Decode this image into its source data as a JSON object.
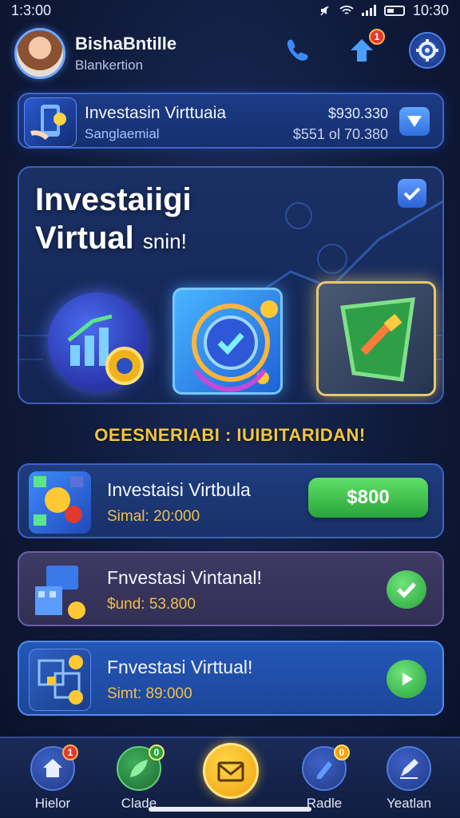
{
  "status": {
    "time": "1:3:00",
    "clock": "10:30"
  },
  "header": {
    "name": "BishaBntille",
    "subtitle": "Blankertion",
    "notif_count": "1"
  },
  "top_card": {
    "title": "Investasin Virttuaia",
    "subtitle": "Sanglaemial",
    "value1": "$930.330",
    "value2": "$551 ol 70.380"
  },
  "hero": {
    "line1": "Investaiigi",
    "line2": "Virtual",
    "line2_small": "snin!"
  },
  "headline": "OEESNERIABI : IUIBITARIDAN!",
  "rows": [
    {
      "title": "Investaisi Virtbula",
      "sub": "Simal: 20:000",
      "action": "$800"
    },
    {
      "title": "Fnvestasi Vintanal!",
      "sub": "$und: 53.800"
    },
    {
      "title": "Fnvestasi Virttual!",
      "sub": "Simt: 89:000"
    }
  ],
  "nav": [
    {
      "label": "Hielor",
      "badge": "1"
    },
    {
      "label": "Clade",
      "badge": "0"
    },
    {
      "label": "Radle",
      "badge": "0"
    },
    {
      "label": "Yeatlan"
    }
  ],
  "colors": {
    "accent": "#3e66c9",
    "gold": "#f3c53a",
    "green": "#2aa43a"
  }
}
